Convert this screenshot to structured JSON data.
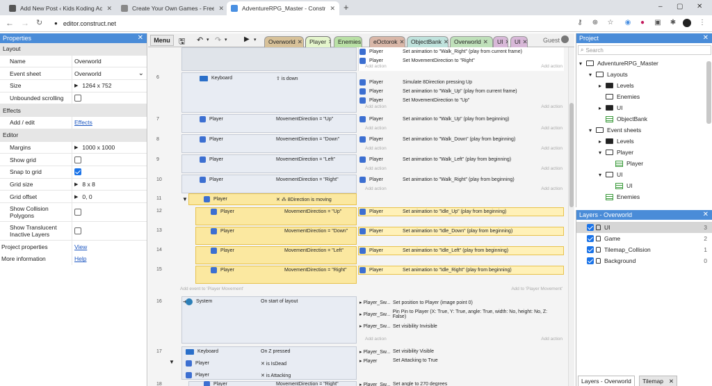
{
  "browser": {
    "tabs": [
      {
        "title": "Add New Post ‹ Kids Koding Aca",
        "fav": "#555"
      },
      {
        "title": "Create Your Own Games - Free Tr",
        "fav": "#888"
      },
      {
        "title": "AdventureRPG_Master - Constru",
        "fav": "#4a90e2"
      }
    ],
    "url": "editor.construct.net"
  },
  "properties": {
    "title": "Properties",
    "rows": [
      {
        "type": "sec",
        "label": "Layout"
      },
      {
        "type": "kv",
        "label": "Name",
        "value": "Overworld"
      },
      {
        "type": "kv",
        "label": "Event sheet",
        "value": "Overworld",
        "select": true
      },
      {
        "type": "kv",
        "label": "Size",
        "value": "1264 x 752",
        "expand": true
      },
      {
        "type": "chk",
        "label": "Unbounded scrolling",
        "checked": false
      },
      {
        "type": "sec",
        "label": "Effects"
      },
      {
        "type": "link",
        "label": "Add / edit",
        "value": "Effects"
      },
      {
        "type": "sec",
        "label": "Editor"
      },
      {
        "type": "kv",
        "label": "Margins",
        "value": "1000 x 1000",
        "expand": true
      },
      {
        "type": "chk",
        "label": "Show grid",
        "checked": false
      },
      {
        "type": "chk",
        "label": "Snap to grid",
        "checked": true
      },
      {
        "type": "kv",
        "label": "Grid size",
        "value": "8 x 8",
        "expand": true
      },
      {
        "type": "kv",
        "label": "Grid offset",
        "value": "0, 0",
        "expand": true
      },
      {
        "type": "chk2",
        "label": "Show Collision Polygons",
        "checked": false
      },
      {
        "type": "chk2",
        "label": "Show Translucent Inactive Layers",
        "checked": false
      },
      {
        "type": "linktop",
        "label": "Project properties",
        "value": "View"
      },
      {
        "type": "linktop",
        "label": "More information",
        "value": "Help"
      }
    ]
  },
  "toolbar": {
    "menu": "Menu",
    "guest": "Guest"
  },
  "layout_tabs": [
    {
      "label": "Overworld",
      "color": "#d7c199"
    },
    {
      "label": "Player",
      "color": "#d4ecb3",
      "active": true
    },
    {
      "label": "Enemies",
      "color": "#b9e0a5"
    },
    {
      "label": "eOctorok",
      "color": "#d9b7a8"
    },
    {
      "label": "ObjectBank",
      "color": "#bfe2dc"
    },
    {
      "label": "Overworld",
      "color": "#bfe0ba"
    },
    {
      "label": "UI",
      "color": "#d8b8d8"
    },
    {
      "label": "UI",
      "color": "#d8b8d8"
    }
  ],
  "events": {
    "add_action": "Add action",
    "add_event_to": "Add event to 'Player Movement'",
    "add_to": "Add to 'Player Movement'",
    "top_actions": [
      {
        "obj": "Player",
        "text": "Set animation to \"Walk_Right\" (play from current frame)"
      },
      {
        "obj": "Player",
        "text": "Set MovementDirection to \"Right\""
      }
    ],
    "ev6": {
      "num": "6",
      "cond_obj": "Keyboard",
      "cond_text": "is down",
      "actions": [
        {
          "obj": "Player",
          "text": "Simulate 8Direction pressing Up"
        },
        {
          "obj": "Player",
          "text": "Set animation to \"Walk_Up\" (play from current frame)"
        },
        {
          "obj": "Player",
          "text": "Set MovementDirection to \"Up\""
        }
      ]
    },
    "simple": [
      {
        "num": "7",
        "obj": "Player",
        "cond": "MovementDirection = \"Up\"",
        "act_obj": "Player",
        "act": "Set animation to \"Walk_Up\" (play from beginning)"
      },
      {
        "num": "8",
        "obj": "Player",
        "cond": "MovementDirection = \"Down\"",
        "act_obj": "Player",
        "act": "Set animation to \"Walk_Down\" (play from beginning)"
      },
      {
        "num": "9",
        "obj": "Player",
        "cond": "MovementDirection = \"Left\"",
        "act_obj": "Player",
        "act": "Set animation to \"Walk_Left\" (play from beginning)"
      },
      {
        "num": "10",
        "obj": "Player",
        "cond": "MovementDirection = \"Right\"",
        "act_obj": "Player",
        "act": "Set animation to \"Walk_Right\" (play from beginning)"
      }
    ],
    "ev11": {
      "num": "11",
      "obj": "Player",
      "cond": "8Direction is moving"
    },
    "sub": [
      {
        "num": "12",
        "obj": "Player",
        "cond": "MovementDirection = \"Up\"",
        "act_obj": "Player",
        "act": "Set animation to \"Idle_Up\" (play from beginning)"
      },
      {
        "num": "13",
        "obj": "Player",
        "cond": "MovementDirection = \"Down\"",
        "act_obj": "Player",
        "act": "Set animation to \"Idle_Down\" (play from beginning)"
      },
      {
        "num": "14",
        "obj": "Player",
        "cond": "MovementDirection = \"Left\"",
        "act_obj": "Player",
        "act": "Set animation to \"Idle_Left\" (play from beginning)"
      },
      {
        "num": "15",
        "obj": "Player",
        "cond": "MovementDirection = \"Right\"",
        "act_obj": "Player",
        "act": "Set animation to \"Idle_Right\" (play from beginning)"
      }
    ],
    "ev16": {
      "num": "16",
      "obj": "System",
      "cond": "On start of layout",
      "actions": [
        {
          "obj": "Player_Sw...",
          "text": "Set position to Player (image point 0)"
        },
        {
          "obj": "Player_Sw...",
          "text": "Pin Pin to Player (X: True, Y: True, angle: True, width: No, height: No, Z: False)"
        },
        {
          "obj": "Player_Sw...",
          "text": "Set visibility Invisible"
        }
      ]
    },
    "ev17": {
      "num": "17",
      "conds": [
        {
          "obj": "Keyboard",
          "text": "On Z pressed"
        },
        {
          "obj": "Player",
          "text": "is IsDead"
        },
        {
          "obj": "Player",
          "text": "is Attacking"
        }
      ],
      "actions": [
        {
          "obj": "Player_Sw...",
          "text": "Set visibility Visible"
        },
        {
          "obj": "Player",
          "text": "Set Attacking to True"
        }
      ]
    },
    "ev18": {
      "num": "18",
      "obj": "Player",
      "cond": "MovementDirection = \"Right\"",
      "act_obj": "Player_Sw...",
      "act": "Set angle to 270 degrees"
    }
  },
  "project": {
    "title": "Project",
    "search_placeholder": "Search",
    "tree": [
      {
        "label": "AdventureRPG_Master",
        "lvl": 0,
        "icon": "folder",
        "arrow": "▾"
      },
      {
        "label": "Layouts",
        "lvl": 1,
        "icon": "folder",
        "arrow": "▾"
      },
      {
        "label": "Levels",
        "lvl": 2,
        "icon": "folderfill",
        "arrow": "▸"
      },
      {
        "label": "Enemies",
        "lvl": 2,
        "icon": "folder",
        "arrow": ""
      },
      {
        "label": "UI",
        "lvl": 2,
        "icon": "folderfill",
        "arrow": "▸"
      },
      {
        "label": "ObjectBank",
        "lvl": 2,
        "icon": "layout",
        "arrow": ""
      },
      {
        "label": "Event sheets",
        "lvl": 1,
        "icon": "folder",
        "arrow": "▾"
      },
      {
        "label": "Levels",
        "lvl": 2,
        "icon": "folderfill",
        "arrow": "▸"
      },
      {
        "label": "Player",
        "lvl": 2,
        "icon": "folder",
        "arrow": "▾"
      },
      {
        "label": "Player",
        "lvl": 3,
        "icon": "sheet",
        "arrow": ""
      },
      {
        "label": "UI",
        "lvl": 2,
        "icon": "folder",
        "arrow": "▾"
      },
      {
        "label": "UI",
        "lvl": 3,
        "icon": "sheet",
        "arrow": ""
      },
      {
        "label": "Enemies",
        "lvl": 2,
        "icon": "sheet",
        "arrow": ""
      }
    ]
  },
  "layers": {
    "title": "Layers - Overworld",
    "items": [
      {
        "name": "UI",
        "idx": "3",
        "selected": true
      },
      {
        "name": "Game",
        "idx": "2"
      },
      {
        "name": "Tilemap_Collision",
        "idx": "1"
      },
      {
        "name": "Background",
        "idx": "0"
      }
    ],
    "bottom_tabs": [
      "Layers - Overworld",
      "Tilemap"
    ]
  }
}
